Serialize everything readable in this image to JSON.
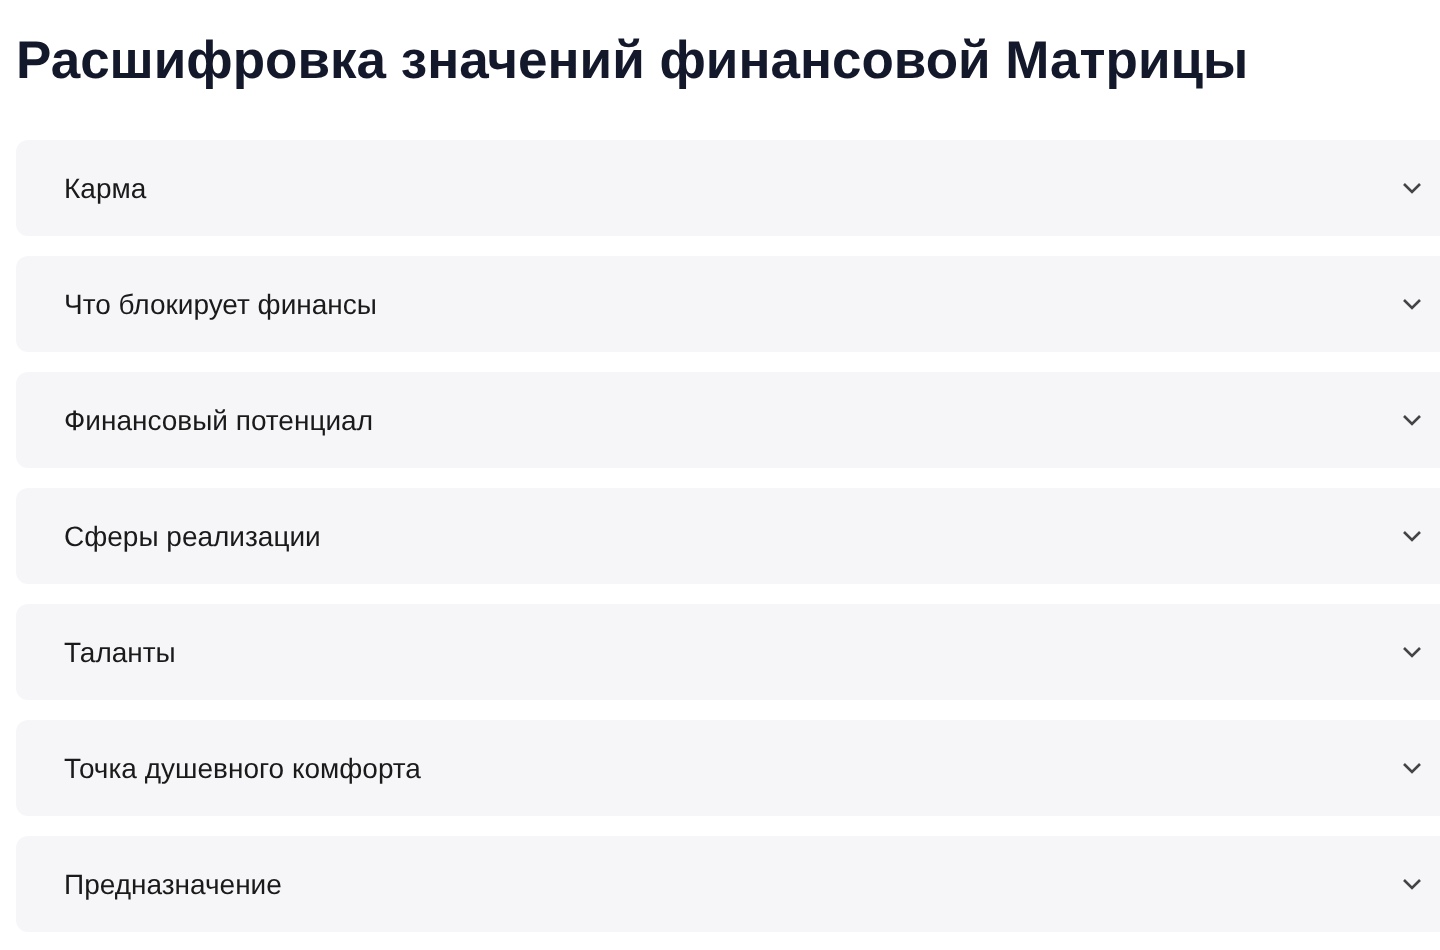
{
  "title": "Расшифровка значений финансовой Матрицы",
  "items": [
    {
      "label": "Карма",
      "expanded": false
    },
    {
      "label": "Что блокирует финансы",
      "expanded": false
    },
    {
      "label": "Финансовый потенциал",
      "expanded": false
    },
    {
      "label": "Сферы реализации",
      "expanded": false
    },
    {
      "label": "Таланты",
      "expanded": false
    },
    {
      "label": "Точка душевного комфорта",
      "expanded": false
    },
    {
      "label": "Предназначение",
      "expanded": false
    }
  ]
}
